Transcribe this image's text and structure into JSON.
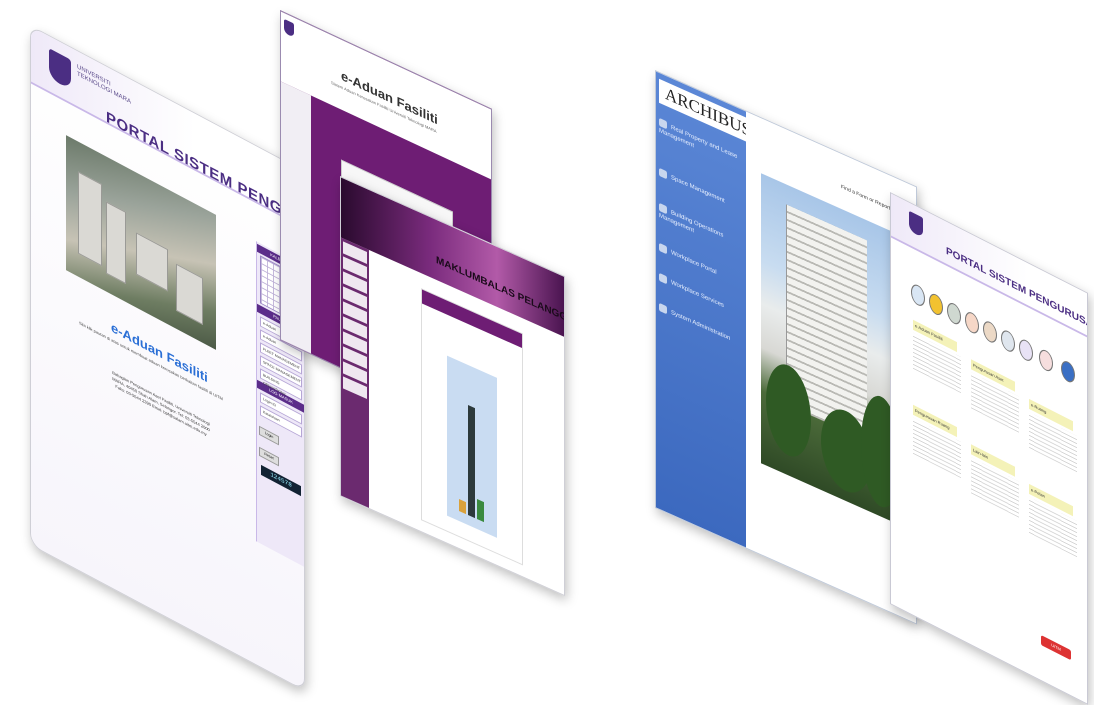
{
  "portal": {
    "title": "PORTAL SISTEM PENGURUSAN FASILITI",
    "university": "UNIVERSITI TEKNOLOGI MARA",
    "brand": "e-Aduan Fasiliti",
    "intro": "Sila klik pautan di atas untuk membuat aduan kerosakan berkaitan fasiliti di UiTM",
    "address": "Bahagian Pengurusan Aset Fasiliti, Universiti Teknologi MARA, 40450 Shah Alam, Selangor. Tel: 03-5544 2000 Faks: 03-5544 2390 Emel: bpf@salam.uitm.edu.my",
    "sidebar": {
      "calendar_header": "KALENDAR",
      "links_header": "PAUTAN",
      "links": [
        "e-Aduan",
        "e-Aduan",
        "FLEET MANAGEMENT",
        "SPACE MANAGEMENT",
        "BUILDING OPERATIONS"
      ],
      "login_header": "LOG MASUK",
      "login_id_label": "Login ID",
      "password_label": "Katalaluan",
      "login_button": "Login",
      "reset_button": "Reset",
      "counter": "124578"
    }
  },
  "eaduan": {
    "title": "e-Aduan Fasiliti",
    "subtitle": "Sistem Aduan Kerosakan Fasiliti Universiti Teknologi MARA"
  },
  "maklumbalas": {
    "title": "MAKLUMBALAS PELANGGAN",
    "chart_values": [
      3,
      28,
      5
    ]
  },
  "archibus": {
    "brand": "ARCHIBUS",
    "nav": [
      "Real Property and Lease Management",
      "Space Management",
      "Building Operations Management",
      "Workplace Portal",
      "Workplace Services",
      "System Administration"
    ],
    "top_links": "Find a Form or Report   Sign Out   Help"
  },
  "portal2": {
    "title": "PORTAL SISTEM PENGURUSAN FASILITI",
    "sections": [
      "e-Aduan Fasiliti",
      "Pengurusan Aset",
      "e-Ruang",
      "Pengurusan Ruang",
      "Lain-lain",
      "e-Pelan"
    ],
    "footer_badge": "UiTM"
  }
}
